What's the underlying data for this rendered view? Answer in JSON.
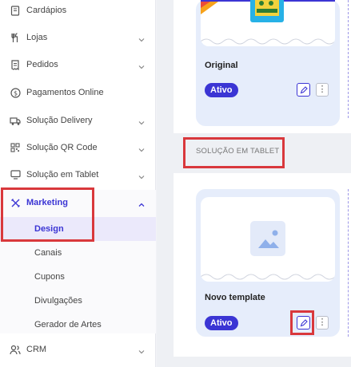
{
  "sidebar": {
    "items": [
      {
        "label": "Cardápios",
        "icon": "menu-book-icon"
      },
      {
        "label": "Lojas",
        "icon": "cutlery-icon"
      },
      {
        "label": "Pedidos",
        "icon": "receipt-icon"
      },
      {
        "label": "Pagamentos Online",
        "icon": "dollar-circle-icon"
      },
      {
        "label": "Solução Delivery",
        "icon": "delivery-truck-icon"
      },
      {
        "label": "Solução QR Code",
        "icon": "qr-code-icon"
      },
      {
        "label": "Solução em Tablet",
        "icon": "monitor-icon"
      },
      {
        "label": "Marketing",
        "icon": "tools-icon"
      },
      {
        "label": "CRM",
        "icon": "users-icon"
      }
    ],
    "marketing_subitems": [
      {
        "label": "Design"
      },
      {
        "label": "Canais"
      },
      {
        "label": "Cupons"
      },
      {
        "label": "Divulgações"
      },
      {
        "label": "Gerador de Artes"
      }
    ]
  },
  "main": {
    "section_title": "SOLUÇÃO EM TABLET",
    "cards": [
      {
        "name": "Original",
        "status": "Ativo"
      },
      {
        "name": "Novo template",
        "status": "Ativo"
      }
    ]
  },
  "colors": {
    "accent": "#3b35d4",
    "highlight": "#d9383c",
    "card_bg": "#e6edfb"
  }
}
